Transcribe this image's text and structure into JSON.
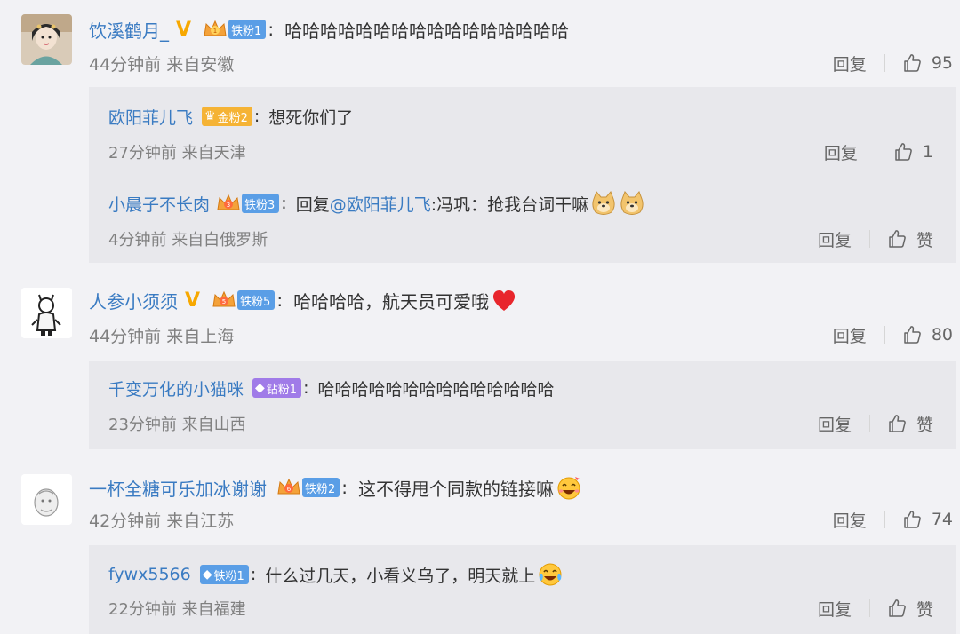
{
  "comments": [
    {
      "username": "饮溪鹤月_",
      "verified": "V",
      "fan_badge": "铁粉1",
      "text": "哈哈哈哈哈哈哈哈哈哈哈哈哈哈哈哈",
      "time": "44分钟前",
      "location": "来自安徽",
      "reply_label": "回复",
      "likes": "95",
      "replies": [
        {
          "username": "欧阳菲儿飞",
          "fan_badge": "金粉2",
          "text": "想死你们了",
          "time": "27分钟前",
          "location": "来自天津",
          "reply_label": "回复",
          "likes": "1"
        },
        {
          "username": "小晨子不长肉",
          "fan_badge": "铁粉3",
          "reply_prefix": "回复",
          "mention": "@欧阳菲儿飞",
          "text": ":冯巩：抢我台词干嘛",
          "time": "4分钟前",
          "location": "来自白俄罗斯",
          "reply_label": "回复",
          "likes": "赞"
        }
      ]
    },
    {
      "username": "人参小须须",
      "verified": "V",
      "fan_badge": "铁粉5",
      "text": "哈哈哈哈，航天员可爱哦",
      "time": "44分钟前",
      "location": "来自上海",
      "reply_label": "回复",
      "likes": "80",
      "replies": [
        {
          "username": "千变万化的小猫咪",
          "fan_badge": "钻粉1",
          "text": "哈哈哈哈哈哈哈哈哈哈哈哈哈哈",
          "time": "23分钟前",
          "location": "来自山西",
          "reply_label": "回复",
          "likes": "赞"
        }
      ]
    },
    {
      "username": "一杯全糖可乐加冰谢谢",
      "fan_badge": "铁粉2",
      "text": "这不得甩个同款的链接嘛",
      "time": "42分钟前",
      "location": "来自江苏",
      "reply_label": "回复",
      "likes": "74",
      "replies": [
        {
          "username": "fywx5566",
          "fan_badge": "铁粉1",
          "text": "什么过几天，小看义乌了，明天就上",
          "time": "22分钟前",
          "location": "来自福建",
          "reply_label": "回复",
          "likes": "赞"
        }
      ]
    }
  ],
  "colors": {
    "background": "#f2f2f5",
    "reply_background": "#e8e8ec",
    "username": "#3a7bc2",
    "verified": "#f7a800",
    "iron_badge": "#5a9ee6",
    "gold_badge": "#f5b335",
    "diamond_badge": "#a07be8"
  }
}
